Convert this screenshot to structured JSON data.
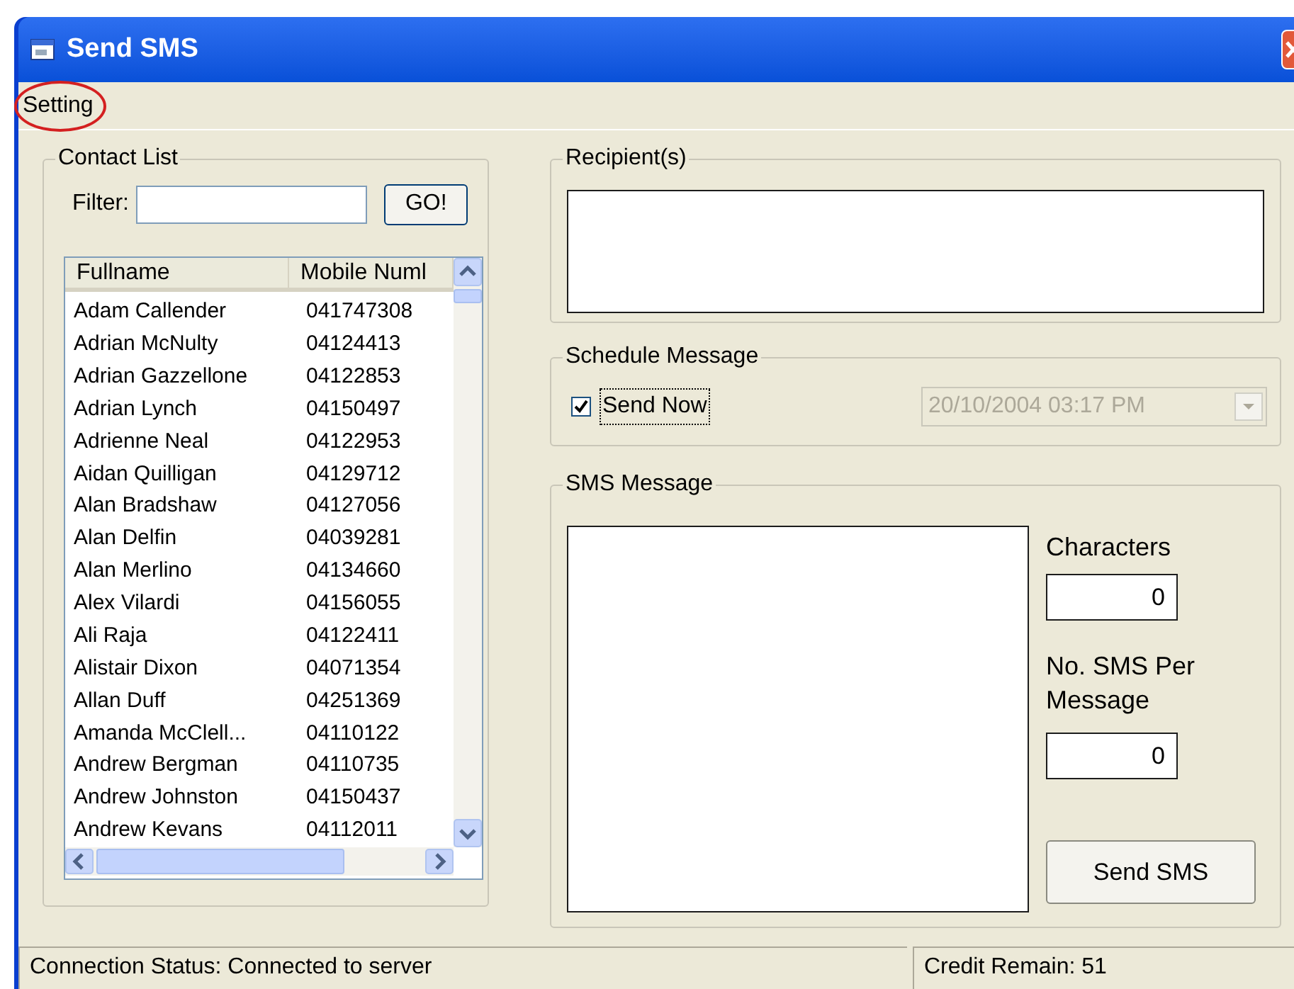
{
  "window": {
    "title": "Send SMS"
  },
  "menu": [
    {
      "label": "Setting",
      "circled": true
    }
  ],
  "contact_list": {
    "title": "Contact List",
    "filter_label": "Filter:",
    "go_button": "GO!",
    "columns": [
      "Fullname",
      "Mobile Numl"
    ],
    "rows": [
      {
        "name": "Adam Callender",
        "mobile": "041747308"
      },
      {
        "name": "Adrian McNulty",
        "mobile": "04124413"
      },
      {
        "name": "Adrian Gazzellone",
        "mobile": "04122853"
      },
      {
        "name": "Adrian Lynch",
        "mobile": "04150497"
      },
      {
        "name": "Adrienne Neal",
        "mobile": "04122953"
      },
      {
        "name": "Aidan Quilligan",
        "mobile": "04129712"
      },
      {
        "name": "Alan Bradshaw",
        "mobile": "04127056"
      },
      {
        "name": "Alan Delfin",
        "mobile": "04039281"
      },
      {
        "name": "Alan Merlino",
        "mobile": "04134660"
      },
      {
        "name": "Alex Vilardi",
        "mobile": "04156055"
      },
      {
        "name": "Ali Raja",
        "mobile": "04122411"
      },
      {
        "name": "Alistair Dixon",
        "mobile": "04071354"
      },
      {
        "name": "Allan Duff",
        "mobile": "04251369"
      },
      {
        "name": "Amanda McClell...",
        "mobile": "04110122"
      },
      {
        "name": "Andrew Bergman",
        "mobile": "04110735"
      },
      {
        "name": "Andrew Johnston",
        "mobile": "04150437"
      },
      {
        "name": "Andrew Kevans",
        "mobile": "04112011"
      }
    ]
  },
  "recipients": {
    "title": "Recipient(s)"
  },
  "schedule": {
    "title": "Schedule Message",
    "send_now": {
      "label": "Send Now",
      "checked": true
    },
    "date": {
      "value": "20/10/2004 03:17 PM",
      "disabled": true
    }
  },
  "sms_message": {
    "title": "SMS Message",
    "characters_label": "Characters",
    "characters_value": "0",
    "per_message_label": "No. SMS Per Message",
    "per_message_value": "0",
    "send_button": "Send SMS"
  },
  "status_bar": [
    "Connection Status: Connected to server",
    "Credit Remain: 51"
  ]
}
